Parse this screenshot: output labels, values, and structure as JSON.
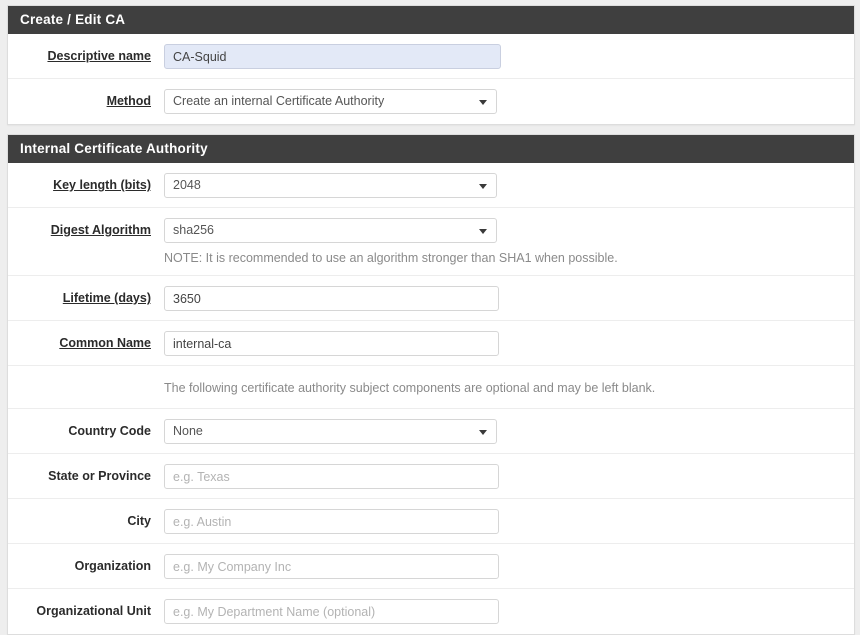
{
  "sections": [
    {
      "id": "create-edit-ca",
      "title": "Create / Edit CA",
      "rows": [
        {
          "id": "descriptive-name",
          "label": "Descriptive name",
          "required": true,
          "control": "text",
          "value": "CA-Squid",
          "placeholder": "",
          "highlighted": true
        },
        {
          "id": "method",
          "label": "Method",
          "required": true,
          "control": "select",
          "value": "Create an internal Certificate Authority"
        }
      ]
    },
    {
      "id": "internal-certificate-authority",
      "title": "Internal Certificate Authority",
      "rows": [
        {
          "id": "key-length",
          "label": "Key length (bits)",
          "required": true,
          "control": "select",
          "value": "2048"
        },
        {
          "id": "digest-algorithm",
          "label": "Digest Algorithm",
          "required": true,
          "control": "select",
          "value": "sha256",
          "note": "NOTE: It is recommended to use an algorithm stronger than SHA1 when possible."
        },
        {
          "id": "lifetime-days",
          "label": "Lifetime (days)",
          "required": true,
          "control": "text",
          "value": "3650",
          "placeholder": ""
        },
        {
          "id": "common-name",
          "label": "Common Name",
          "required": true,
          "control": "text",
          "value": "internal-ca",
          "placeholder": ""
        },
        {
          "id": "optional-components-note",
          "label": "",
          "control": "info",
          "text": "The following certificate authority subject components are optional and may be left blank."
        },
        {
          "id": "country-code",
          "label": "Country Code",
          "required": false,
          "control": "select",
          "value": "None"
        },
        {
          "id": "state-or-province",
          "label": "State or Province",
          "required": false,
          "control": "text",
          "value": "",
          "placeholder": "e.g. Texas"
        },
        {
          "id": "city",
          "label": "City",
          "required": false,
          "control": "text",
          "value": "",
          "placeholder": "e.g. Austin"
        },
        {
          "id": "organization",
          "label": "Organization",
          "required": false,
          "control": "text",
          "value": "",
          "placeholder": "e.g. My Company Inc"
        },
        {
          "id": "organizational-unit",
          "label": "Organizational Unit",
          "required": false,
          "control": "text",
          "value": "",
          "placeholder": "e.g. My Department Name (optional)"
        }
      ]
    }
  ],
  "icons": {
    "caret": "chevron-down-icon"
  },
  "colors": {
    "panel_heading_bg": "#3f3f3f",
    "panel_bg": "#ffffff",
    "page_bg": "#eeeeee",
    "highlight_input_bg": "#e3e9f7",
    "note_text": "#8a8a8a"
  }
}
